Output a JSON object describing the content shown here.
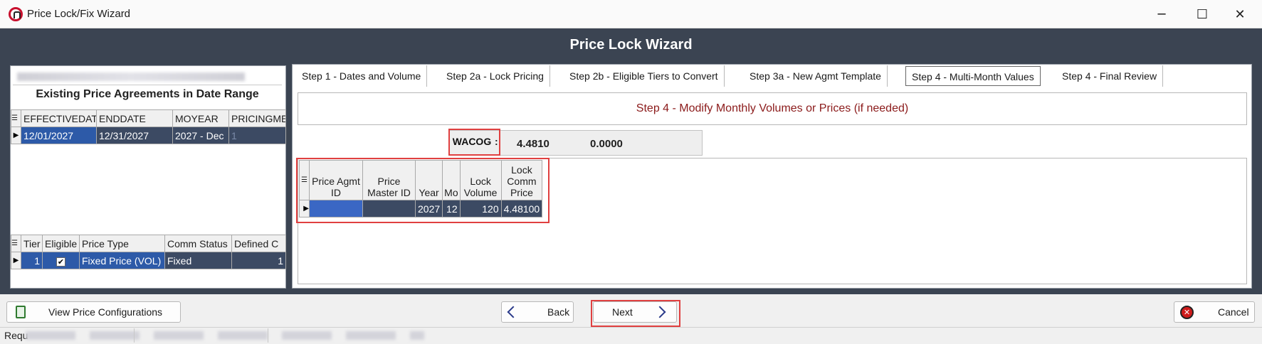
{
  "window": {
    "title": "Price Lock/Fix Wizard",
    "controls": {
      "minimize": "─",
      "maximize": "☐",
      "close": "✕"
    }
  },
  "header": {
    "title": "Price Lock Wizard"
  },
  "left_panel": {
    "agreements_title": "Existing Price Agreements in Date Range",
    "agreements_columns": [
      "EFFECTIVEDATE",
      "ENDDATE",
      "MOYEAR",
      "PRICINGMET"
    ],
    "agreements_rows": [
      [
        "12/01/2027",
        "12/31/2027",
        "2027 - Dec",
        "1"
      ]
    ],
    "tiers_columns": [
      "Tier",
      "Eligible",
      "Price Type",
      "Comm Status",
      "Defined C"
    ],
    "tiers_rows": [
      {
        "tier": "1",
        "eligible": "✔",
        "price_type": "Fixed Price (VOL)",
        "comm_status": "Fixed",
        "defined": "1"
      }
    ]
  },
  "tabs": [
    "Step 1 - Dates and Volume",
    "Step 2a - Lock Pricing",
    "Step 2b - Eligible Tiers to Convert",
    "Step 3a - New Agmt Template",
    "Step 4 - Multi-Month Values",
    "Step 4 - Final Review"
  ],
  "active_tab": "Step 4 - Multi-Month Values",
  "step": {
    "heading": "Step 4 - Modify Monthly Volumes or Prices (if needed)",
    "wacog_label": "WACOG",
    "wacog_colon": ":",
    "wacog_value1": "4.4810",
    "wacog_value2": "0.0000"
  },
  "values_grid": {
    "columns": [
      "Price Agmt ID",
      "Price Master ID",
      "Year",
      "Mo",
      "Lock Volume",
      "Lock Comm Price"
    ],
    "rows": [
      [
        "",
        "",
        "2027",
        "12",
        "120",
        "4.48100"
      ]
    ]
  },
  "buttons": {
    "view_config": "View Price Configurations",
    "back": "Back",
    "next": "Next",
    "cancel": "Cancel"
  },
  "status": {
    "text": "Requ"
  },
  "colors": {
    "header_bg": "#3b4452",
    "selection": "#2d5aa8",
    "heading_text": "#8b1a1a",
    "highlight": "#e04040"
  }
}
